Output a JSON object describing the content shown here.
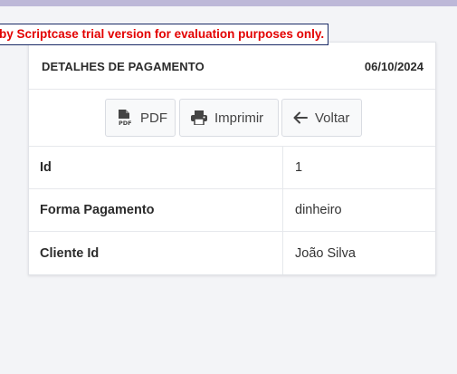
{
  "banner": {
    "text": "by Scriptcase trial version for evaluation purposes only."
  },
  "header": {
    "title": "DETALHES DE PAGAMENTO",
    "date": "06/10/2024"
  },
  "toolbar": {
    "pdf_label": "PDF",
    "pdf_icon": "pdf-icon",
    "print_label": "Imprimir",
    "print_icon": "printer-icon",
    "back_label": "Voltar",
    "back_icon": "arrow-left-icon"
  },
  "details": [
    {
      "label": "Id",
      "value": "1"
    },
    {
      "label": "Forma Pagamento",
      "value": "dinheiro"
    },
    {
      "label": "Cliente Id",
      "value": "João Silva"
    }
  ],
  "colors": {
    "top_bar": "#bdb8d8",
    "banner_text": "#e30000",
    "banner_border": "#1a2a66"
  }
}
